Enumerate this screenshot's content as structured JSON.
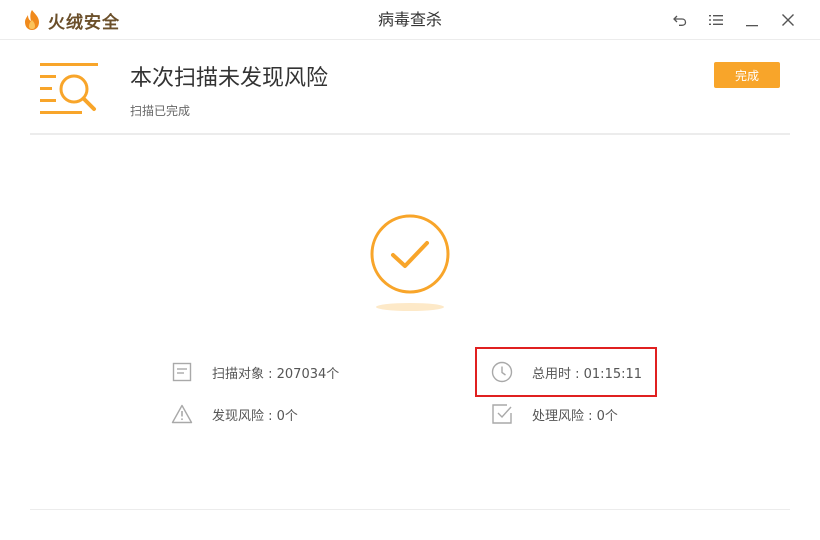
{
  "app": {
    "brand_name": "火绒安全",
    "window_title": "病毒查杀"
  },
  "window_controls": {
    "back_icon": "undo-arrow-icon",
    "menu_icon": "list-menu-icon",
    "minimize_icon": "minimize-icon",
    "close_icon": "close-icon"
  },
  "result": {
    "title": "本次扫描未发现风险",
    "subtitle": "扫描已完成",
    "done_label": "完成",
    "status_icon": "check-circle-icon"
  },
  "stats": {
    "objects": "扫描对象 : 207034个",
    "risks_found": "发现风险 : 0个",
    "total_time": "总用时 : 01:15:11",
    "risks_handled": "处理风险 : 0个"
  },
  "colors": {
    "accent": "#f8a52a",
    "highlight": "#e02020",
    "icon_gray": "#a9a9a9"
  }
}
